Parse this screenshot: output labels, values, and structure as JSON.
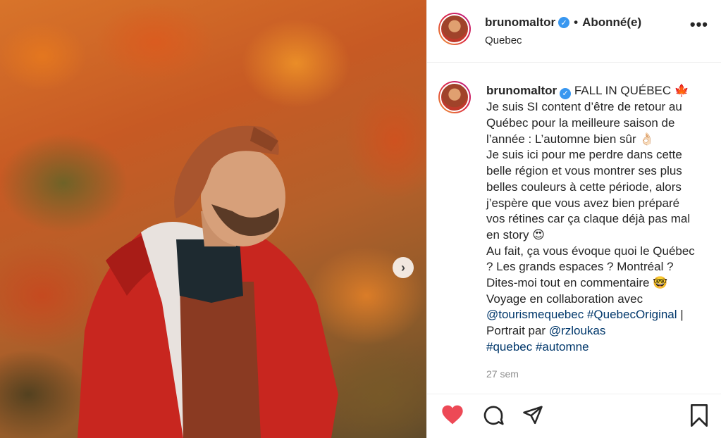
{
  "post": {
    "username": "brunomaltor",
    "verified_glyph": "✓",
    "follow_status": "Abonné(e)",
    "location": "Quebec",
    "more_glyph": "•••",
    "arrow_glyph": "›",
    "caption_lines": [
      "FALL IN QUÉBEC 🍁",
      "Je suis SI content d’être de retour au",
      "Québec pour la meilleure saison de",
      "l’année : L’automne bien sûr 👌🏻",
      "Je suis ici pour me perdre dans cette",
      "belle région et vous montrer ses plus",
      "belles couleurs à cette période, alors",
      "j’espère que vous avez bien préparé",
      "vos rétines car ça claque déjà pas mal",
      "en story 😍",
      "Au fait, ça vous évoque quoi le Québec",
      "? Les grands espaces ? Montréal ?",
      "Dites-moi tout en commentaire 🤓",
      "Voyage en collaboration avec"
    ],
    "tag_line_1": {
      "tag_a": "@tourismequebec",
      "tag_b": "#QuebecOriginal",
      "suffix": " |"
    },
    "portrait_prefix": "Portrait par ",
    "portrait_tag": "@rzloukas",
    "hashtag_1": "#quebec",
    "hashtag_2": "#automne",
    "time_ago": "27 sem"
  },
  "colors": {
    "like": "#ed4956",
    "link": "#00376b",
    "verified": "#3897f0"
  },
  "icons": [
    "heart-icon",
    "comment-icon",
    "share-icon",
    "bookmark-icon",
    "chevron-right-icon",
    "more-icon",
    "verified-badge-icon"
  ]
}
